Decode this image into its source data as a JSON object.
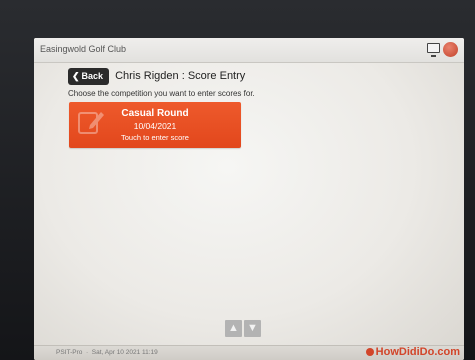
{
  "app": {
    "club_name": "Easingwold Golf Club"
  },
  "header": {
    "back_label": "Back",
    "title": "Chris Rigden : Score Entry"
  },
  "instruction": "Choose the competition you want to enter scores for.",
  "competitions": [
    {
      "name": "Casual Round",
      "date": "10/04/2021",
      "hint": "Touch to enter score",
      "color": "#e84e22"
    }
  ],
  "footer": {
    "system": "PSIT-Pro",
    "datetime": "Sat, Apr 10 2021 11:19",
    "brand": "HowDidiDo.com"
  },
  "icons": {
    "back": "chevron-left-icon",
    "monitor": "monitor-icon",
    "power": "power-icon",
    "pen": "pen-icon",
    "scroll_up": "arrow-up-icon",
    "scroll_down": "arrow-down-icon"
  },
  "colors": {
    "accent": "#e84e22",
    "back_button": "#2b2b2b"
  }
}
